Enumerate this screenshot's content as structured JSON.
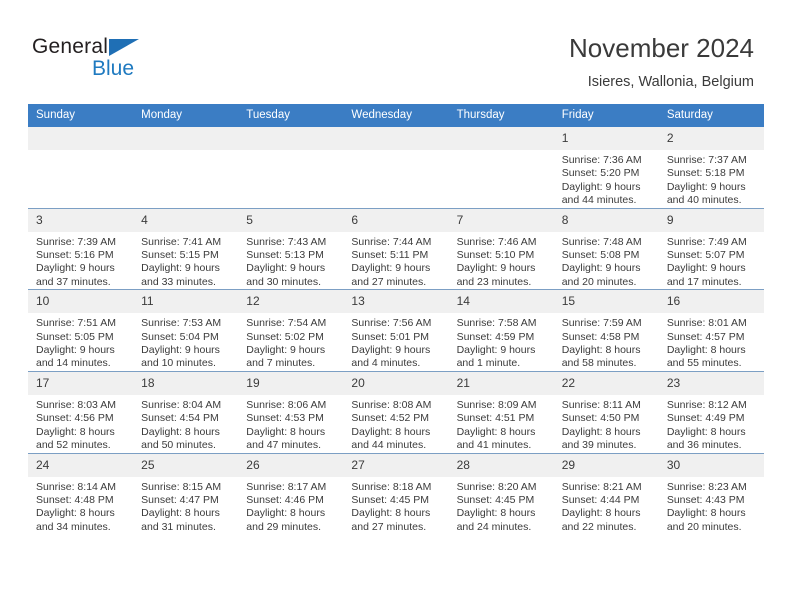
{
  "brand": {
    "line1": "General",
    "line2": "Blue",
    "logo_icon": "triangle-icon"
  },
  "header": {
    "title": "November 2024",
    "subtitle": "Isieres, Wallonia, Belgium"
  },
  "calendar": {
    "weekday_headers": [
      "Sunday",
      "Monday",
      "Tuesday",
      "Wednesday",
      "Thursday",
      "Friday",
      "Saturday"
    ],
    "header_bg": "#3b7dc4",
    "daynum_bg": "#f0f0f0",
    "row_border": "#7c9fc4",
    "weeks": [
      [
        {
          "day": "",
          "sunrise": "",
          "sunset": "",
          "daylight1": "",
          "daylight2": ""
        },
        {
          "day": "",
          "sunrise": "",
          "sunset": "",
          "daylight1": "",
          "daylight2": ""
        },
        {
          "day": "",
          "sunrise": "",
          "sunset": "",
          "daylight1": "",
          "daylight2": ""
        },
        {
          "day": "",
          "sunrise": "",
          "sunset": "",
          "daylight1": "",
          "daylight2": ""
        },
        {
          "day": "",
          "sunrise": "",
          "sunset": "",
          "daylight1": "",
          "daylight2": ""
        },
        {
          "day": "1",
          "sunrise": "Sunrise: 7:36 AM",
          "sunset": "Sunset: 5:20 PM",
          "daylight1": "Daylight: 9 hours",
          "daylight2": "and 44 minutes."
        },
        {
          "day": "2",
          "sunrise": "Sunrise: 7:37 AM",
          "sunset": "Sunset: 5:18 PM",
          "daylight1": "Daylight: 9 hours",
          "daylight2": "and 40 minutes."
        }
      ],
      [
        {
          "day": "3",
          "sunrise": "Sunrise: 7:39 AM",
          "sunset": "Sunset: 5:16 PM",
          "daylight1": "Daylight: 9 hours",
          "daylight2": "and 37 minutes."
        },
        {
          "day": "4",
          "sunrise": "Sunrise: 7:41 AM",
          "sunset": "Sunset: 5:15 PM",
          "daylight1": "Daylight: 9 hours",
          "daylight2": "and 33 minutes."
        },
        {
          "day": "5",
          "sunrise": "Sunrise: 7:43 AM",
          "sunset": "Sunset: 5:13 PM",
          "daylight1": "Daylight: 9 hours",
          "daylight2": "and 30 minutes."
        },
        {
          "day": "6",
          "sunrise": "Sunrise: 7:44 AM",
          "sunset": "Sunset: 5:11 PM",
          "daylight1": "Daylight: 9 hours",
          "daylight2": "and 27 minutes."
        },
        {
          "day": "7",
          "sunrise": "Sunrise: 7:46 AM",
          "sunset": "Sunset: 5:10 PM",
          "daylight1": "Daylight: 9 hours",
          "daylight2": "and 23 minutes."
        },
        {
          "day": "8",
          "sunrise": "Sunrise: 7:48 AM",
          "sunset": "Sunset: 5:08 PM",
          "daylight1": "Daylight: 9 hours",
          "daylight2": "and 20 minutes."
        },
        {
          "day": "9",
          "sunrise": "Sunrise: 7:49 AM",
          "sunset": "Sunset: 5:07 PM",
          "daylight1": "Daylight: 9 hours",
          "daylight2": "and 17 minutes."
        }
      ],
      [
        {
          "day": "10",
          "sunrise": "Sunrise: 7:51 AM",
          "sunset": "Sunset: 5:05 PM",
          "daylight1": "Daylight: 9 hours",
          "daylight2": "and 14 minutes."
        },
        {
          "day": "11",
          "sunrise": "Sunrise: 7:53 AM",
          "sunset": "Sunset: 5:04 PM",
          "daylight1": "Daylight: 9 hours",
          "daylight2": "and 10 minutes."
        },
        {
          "day": "12",
          "sunrise": "Sunrise: 7:54 AM",
          "sunset": "Sunset: 5:02 PM",
          "daylight1": "Daylight: 9 hours",
          "daylight2": "and 7 minutes."
        },
        {
          "day": "13",
          "sunrise": "Sunrise: 7:56 AM",
          "sunset": "Sunset: 5:01 PM",
          "daylight1": "Daylight: 9 hours",
          "daylight2": "and 4 minutes."
        },
        {
          "day": "14",
          "sunrise": "Sunrise: 7:58 AM",
          "sunset": "Sunset: 4:59 PM",
          "daylight1": "Daylight: 9 hours",
          "daylight2": "and 1 minute."
        },
        {
          "day": "15",
          "sunrise": "Sunrise: 7:59 AM",
          "sunset": "Sunset: 4:58 PM",
          "daylight1": "Daylight: 8 hours",
          "daylight2": "and 58 minutes."
        },
        {
          "day": "16",
          "sunrise": "Sunrise: 8:01 AM",
          "sunset": "Sunset: 4:57 PM",
          "daylight1": "Daylight: 8 hours",
          "daylight2": "and 55 minutes."
        }
      ],
      [
        {
          "day": "17",
          "sunrise": "Sunrise: 8:03 AM",
          "sunset": "Sunset: 4:56 PM",
          "daylight1": "Daylight: 8 hours",
          "daylight2": "and 52 minutes."
        },
        {
          "day": "18",
          "sunrise": "Sunrise: 8:04 AM",
          "sunset": "Sunset: 4:54 PM",
          "daylight1": "Daylight: 8 hours",
          "daylight2": "and 50 minutes."
        },
        {
          "day": "19",
          "sunrise": "Sunrise: 8:06 AM",
          "sunset": "Sunset: 4:53 PM",
          "daylight1": "Daylight: 8 hours",
          "daylight2": "and 47 minutes."
        },
        {
          "day": "20",
          "sunrise": "Sunrise: 8:08 AM",
          "sunset": "Sunset: 4:52 PM",
          "daylight1": "Daylight: 8 hours",
          "daylight2": "and 44 minutes."
        },
        {
          "day": "21",
          "sunrise": "Sunrise: 8:09 AM",
          "sunset": "Sunset: 4:51 PM",
          "daylight1": "Daylight: 8 hours",
          "daylight2": "and 41 minutes."
        },
        {
          "day": "22",
          "sunrise": "Sunrise: 8:11 AM",
          "sunset": "Sunset: 4:50 PM",
          "daylight1": "Daylight: 8 hours",
          "daylight2": "and 39 minutes."
        },
        {
          "day": "23",
          "sunrise": "Sunrise: 8:12 AM",
          "sunset": "Sunset: 4:49 PM",
          "daylight1": "Daylight: 8 hours",
          "daylight2": "and 36 minutes."
        }
      ],
      [
        {
          "day": "24",
          "sunrise": "Sunrise: 8:14 AM",
          "sunset": "Sunset: 4:48 PM",
          "daylight1": "Daylight: 8 hours",
          "daylight2": "and 34 minutes."
        },
        {
          "day": "25",
          "sunrise": "Sunrise: 8:15 AM",
          "sunset": "Sunset: 4:47 PM",
          "daylight1": "Daylight: 8 hours",
          "daylight2": "and 31 minutes."
        },
        {
          "day": "26",
          "sunrise": "Sunrise: 8:17 AM",
          "sunset": "Sunset: 4:46 PM",
          "daylight1": "Daylight: 8 hours",
          "daylight2": "and 29 minutes."
        },
        {
          "day": "27",
          "sunrise": "Sunrise: 8:18 AM",
          "sunset": "Sunset: 4:45 PM",
          "daylight1": "Daylight: 8 hours",
          "daylight2": "and 27 minutes."
        },
        {
          "day": "28",
          "sunrise": "Sunrise: 8:20 AM",
          "sunset": "Sunset: 4:45 PM",
          "daylight1": "Daylight: 8 hours",
          "daylight2": "and 24 minutes."
        },
        {
          "day": "29",
          "sunrise": "Sunrise: 8:21 AM",
          "sunset": "Sunset: 4:44 PM",
          "daylight1": "Daylight: 8 hours",
          "daylight2": "and 22 minutes."
        },
        {
          "day": "30",
          "sunrise": "Sunrise: 8:23 AM",
          "sunset": "Sunset: 4:43 PM",
          "daylight1": "Daylight: 8 hours",
          "daylight2": "and 20 minutes."
        }
      ]
    ]
  }
}
